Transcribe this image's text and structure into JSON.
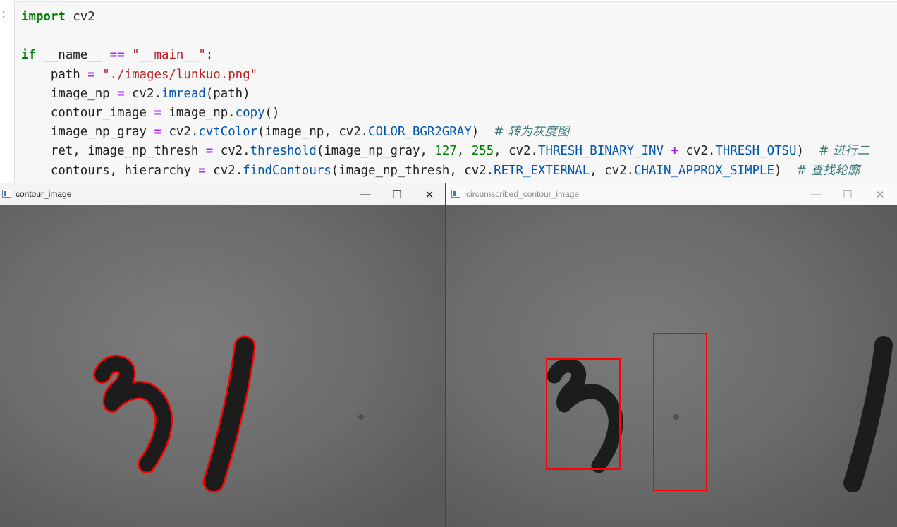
{
  "notebook": {
    "prompt": ":",
    "code": {
      "l1_kw": "import",
      "l1_rest": " cv2",
      "l3_kw": "if",
      "l3_a": " __name__ ",
      "l3_op": "==",
      "l3_sp": " ",
      "l3_str": "\"__main__\"",
      "l3_b": ":",
      "l4_a": "    path ",
      "l4_op": "=",
      "l4_sp": " ",
      "l4_str": "\"./images/lunkuo.png\"",
      "l5_a": "    image_np ",
      "l5_op": "=",
      "l5_b": " cv2.",
      "l5_fn": "imread",
      "l5_c": "(path)",
      "l6_a": "    contour_image ",
      "l6_op": "=",
      "l6_b": " image_np.",
      "l6_fn": "copy",
      "l6_c": "()",
      "l7_a": "    image_np_gray ",
      "l7_op": "=",
      "l7_b": " cv2.",
      "l7_fn": "cvtColor",
      "l7_c": "(image_np, cv2.",
      "l7_const": "COLOR_BGR2GRAY",
      "l7_d": ")  ",
      "l7_cm": "# 转为灰度图",
      "l8_a": "    ret, image_np_thresh ",
      "l8_op": "=",
      "l8_b": " cv2.",
      "l8_fn": "threshold",
      "l8_c": "(image_np_gray, ",
      "l8_n1": "127",
      "l8_d": ", ",
      "l8_n2": "255",
      "l8_e": ", cv2.",
      "l8_const1": "THRESH_BINARY_INV",
      "l8_f": " ",
      "l8_op2": "+",
      "l8_g": " cv2.",
      "l8_const2": "THRESH_OTSU",
      "l8_h": ")  ",
      "l8_cm": "# 进行二",
      "l9_a": "    contours, hierarchy ",
      "l9_op": "=",
      "l9_b": " cv2.",
      "l9_fn": "findContours",
      "l9_c": "(image_np_thresh, cv2.",
      "l9_const1": "RETR_EXTERNAL",
      "l9_d": ", cv2.",
      "l9_const2": "CHAIN_APPROX_SIMPLE",
      "l9_e": ")  ",
      "l9_cm": "# 查找轮廓"
    }
  },
  "windows": [
    {
      "title": "contour_image",
      "minimize": "—",
      "maximize": "☐",
      "close": "✕",
      "focused": true
    },
    {
      "title": "circumscribed_contour_image",
      "minimize": "—",
      "maximize": "☐",
      "close": "✕",
      "focused": false
    }
  ],
  "colors": {
    "contour": "#ff0000",
    "ink": "#1c1c1c",
    "paper": "#6b6b6b"
  }
}
